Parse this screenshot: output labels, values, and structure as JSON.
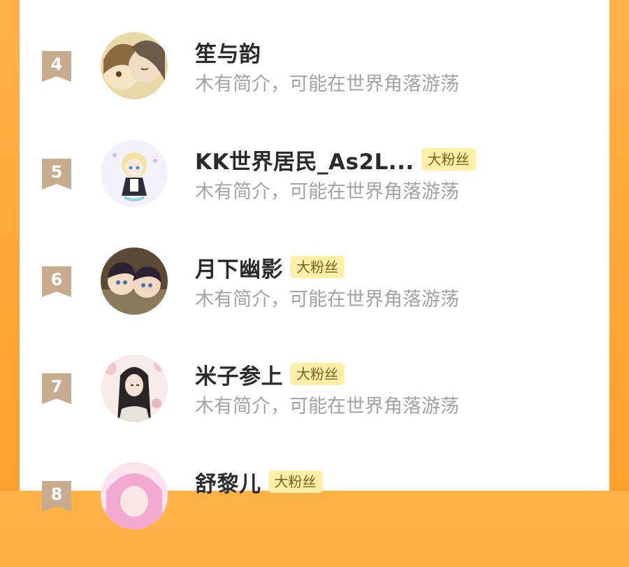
{
  "users": [
    {
      "rank": "4",
      "name": "笙与韵",
      "badge": "",
      "bio": "木有简介，可能在世界角落游荡",
      "avatar": "anime-couple-avatar"
    },
    {
      "rank": "5",
      "name": "KK世界居民_As2L...",
      "badge": "大粉丝",
      "bio": "木有简介，可能在世界角落游荡",
      "avatar": "chibi-maid-avatar"
    },
    {
      "rank": "6",
      "name": "月下幽影",
      "badge": "大粉丝",
      "bio": "木有简介，可能在世界角落游荡",
      "avatar": "anime-boys-avatar"
    },
    {
      "rank": "7",
      "name": "米子参上",
      "badge": "大粉丝",
      "bio": "木有简介，可能在世界角落游荡",
      "avatar": "ancient-style-avatar"
    },
    {
      "rank": "8",
      "name": "舒黎儿",
      "badge": "大粉丝",
      "bio": "",
      "avatar": "pink-hair-avatar"
    }
  ],
  "colors": {
    "background": "#ff9f2e",
    "rank_badge": "#c7ab8d",
    "fan_badge_bg": "#fff0a8",
    "name_text": "#2b2b2b",
    "bio_text": "#a3a3a3"
  }
}
